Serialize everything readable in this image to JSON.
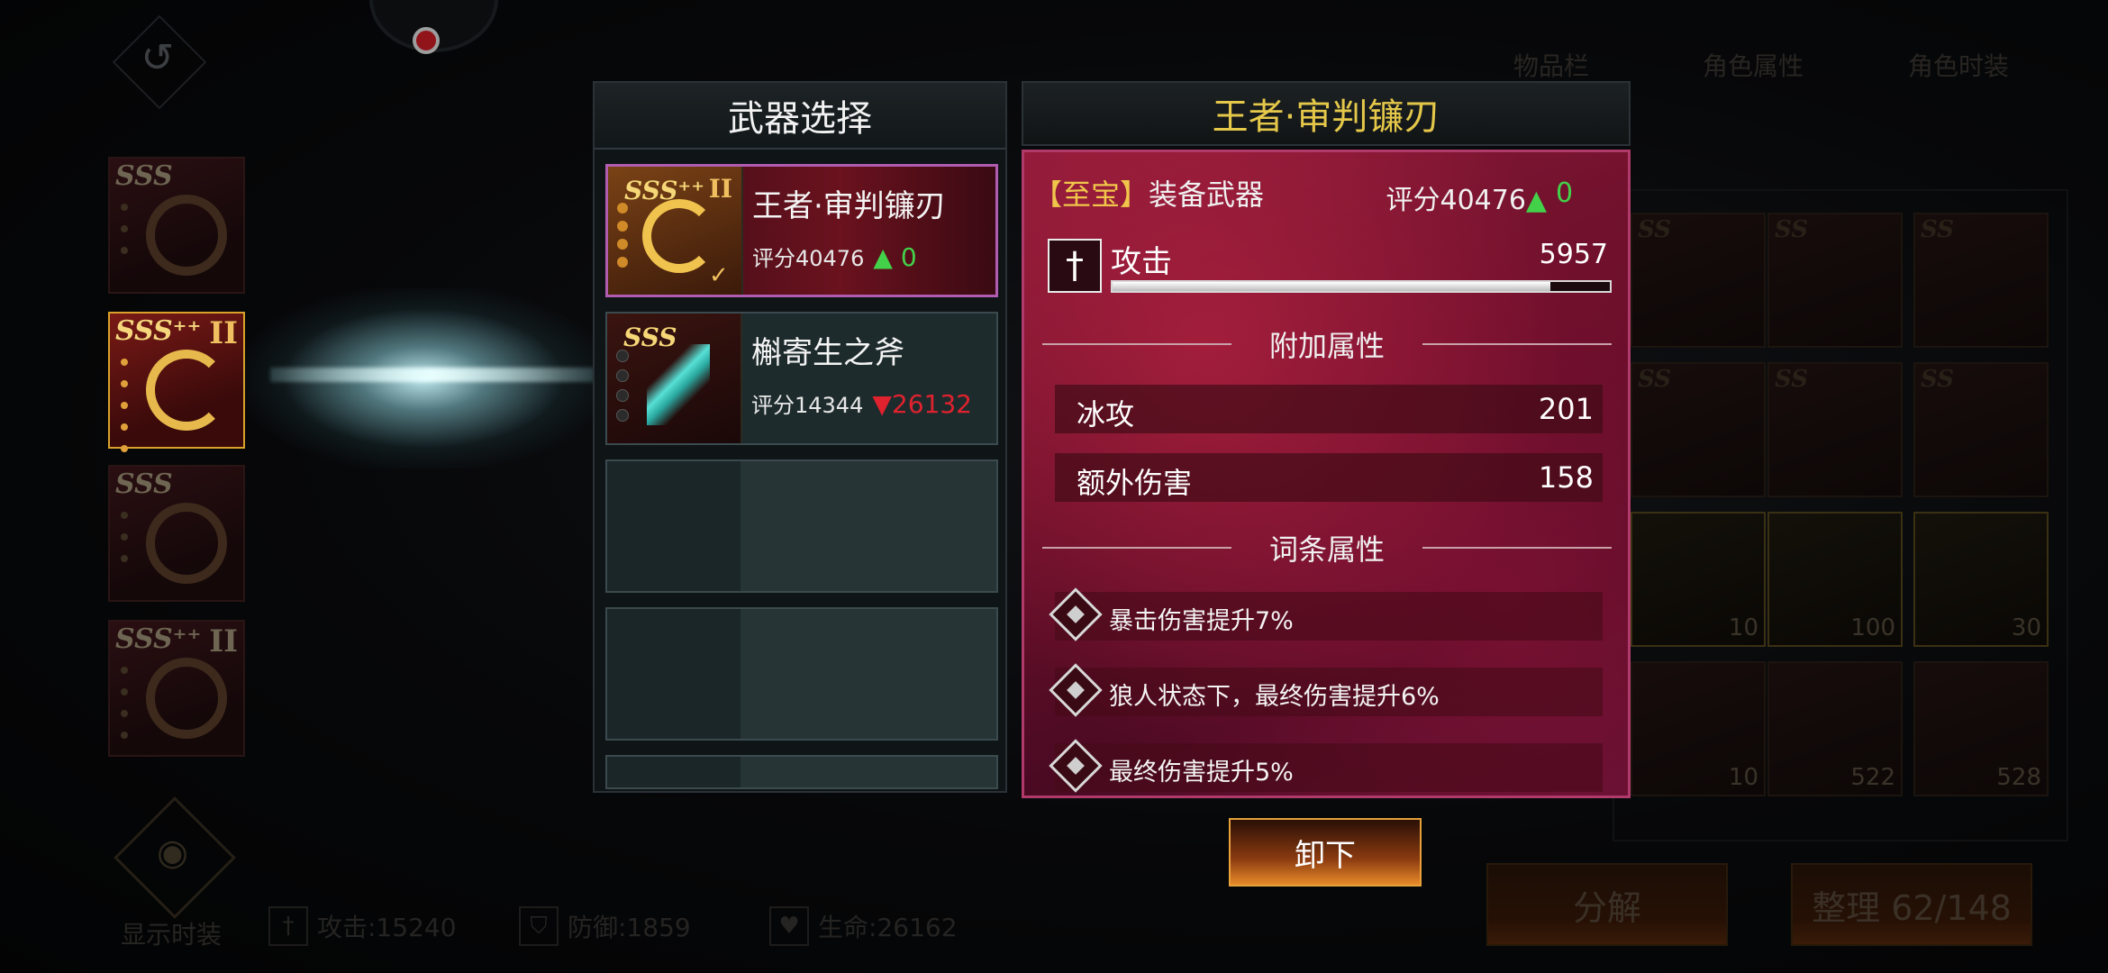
{
  "weapon_select": {
    "title": "武器选择",
    "items": [
      {
        "grade": "SSS⁺⁺",
        "roman": "II",
        "name": "王者·审判镰刃",
        "score": "评分40476",
        "delta_sign": "▲",
        "delta": "0"
      },
      {
        "grade": "SSS",
        "name": "槲寄生之斧",
        "score": "评分14344",
        "delta_sign": "▼",
        "delta": "26132"
      }
    ]
  },
  "detail": {
    "title": "王者·审判镰刃",
    "rank_bracket_open": "【",
    "rank": "至宝",
    "rank_bracket_close": "】",
    "equip_label": "装备武器",
    "score": "评分40476",
    "score_sign": "▲",
    "score_delta": "0",
    "attack_label": "攻击",
    "attack_value": "5957",
    "extra_header": "附加属性",
    "extra_attrs": [
      {
        "name": "冰攻",
        "value": "201"
      },
      {
        "name": "额外伤害",
        "value": "158"
      }
    ],
    "affix_header": "词条属性",
    "affixes": [
      "暴击伤害提升7%",
      "狼人状态下，最终伤害提升6%",
      "最终伤害提升5%"
    ],
    "unequip_label": "卸下"
  },
  "left_slots": [
    {
      "grade": "SSS"
    },
    {
      "grade": "SSS⁺⁺",
      "roman": "II"
    },
    {
      "grade": "SSS"
    },
    {
      "grade": "SSS⁺⁺",
      "roman": "II"
    }
  ],
  "inventory": {
    "tabs": [
      "物品栏",
      "角色属性",
      "角色时装"
    ],
    "counts": [
      "10",
      "100",
      "30",
      "10",
      "522",
      "528"
    ],
    "decompose_label": "分解",
    "sort_label": "整理 62/148"
  },
  "bottom": {
    "show_fashion": "显示时装",
    "attack": "攻击:15240",
    "defense": "防御:1859",
    "life": "生命:26162"
  },
  "icons": {
    "back": "back-arrow-icon",
    "eye": "eye-icon"
  }
}
